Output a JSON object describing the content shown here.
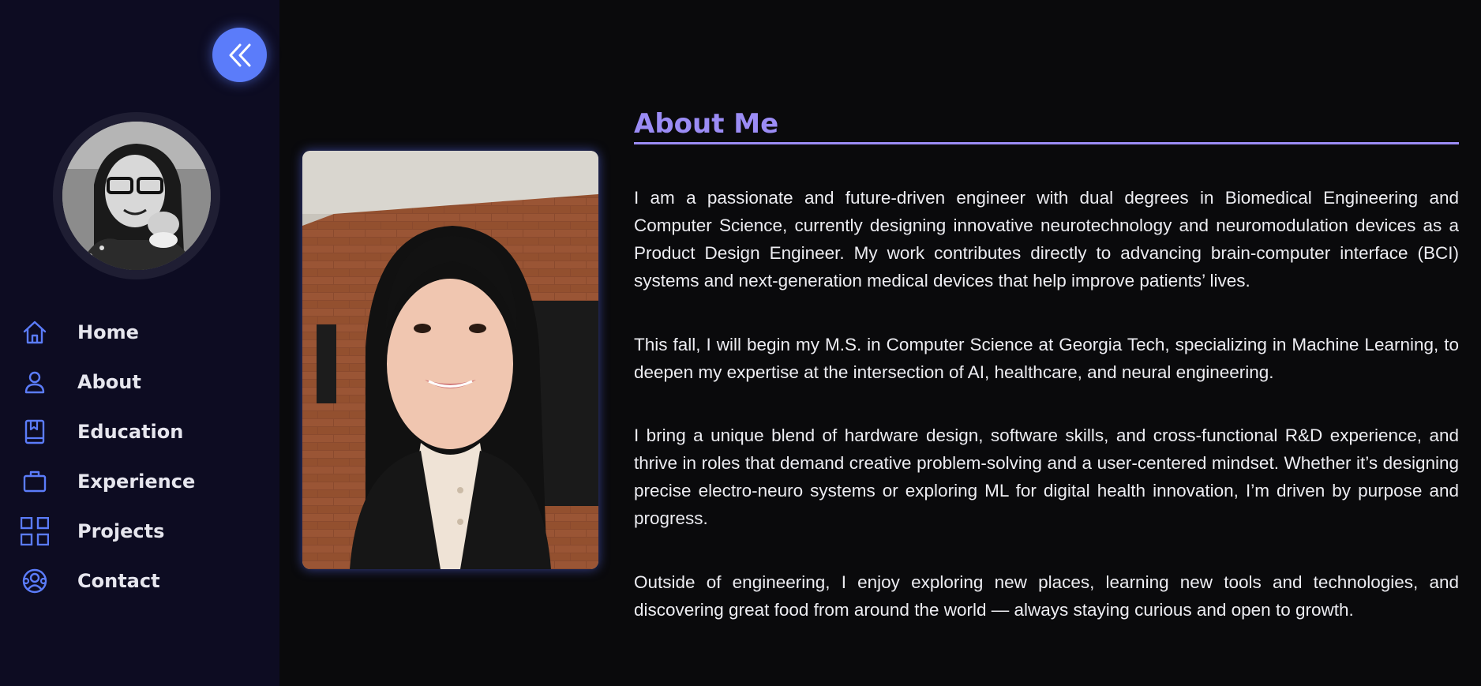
{
  "sidebar": {
    "collapse_icon": "double-chevron-left-icon",
    "accent_color": "#5b7cfa",
    "nav": [
      {
        "label": "Home",
        "icon": "home-icon"
      },
      {
        "label": "About",
        "icon": "user-icon"
      },
      {
        "label": "Education",
        "icon": "book-icon"
      },
      {
        "label": "Experience",
        "icon": "briefcase-icon"
      },
      {
        "label": "Projects",
        "icon": "grid-icon"
      },
      {
        "label": "Contact",
        "icon": "contact-icon"
      }
    ]
  },
  "main": {
    "heading": "About Me",
    "heading_color": "#9b8cf5",
    "paragraphs": [
      "I am a passionate and future-driven engineer with dual degrees in Biomedical Engineering and Computer Science, currently designing innovative neurotechnology and neuromodulation devices as a Product Design Engineer. My work contributes directly to advancing brain-computer interface (BCI) systems and next-generation medical devices that help improve patients’ lives.",
      "This fall, I will begin my M.S. in Computer Science at Georgia Tech, specializing in Machine Learning, to deepen my expertise at the intersection of AI, healthcare, and neural engineering.",
      "I bring a unique blend of hardware design, software skills, and cross-functional R&D experience, and thrive in roles that demand creative problem-solving and a user-centered mindset. Whether it’s designing precise electro-neuro systems or exploring ML for digital health innovation, I’m driven by purpose and progress.",
      "Outside of engineering, I enjoy exploring new places, learning new tools and technologies, and discovering great food from around the world — always staying curious and open to growth."
    ]
  }
}
